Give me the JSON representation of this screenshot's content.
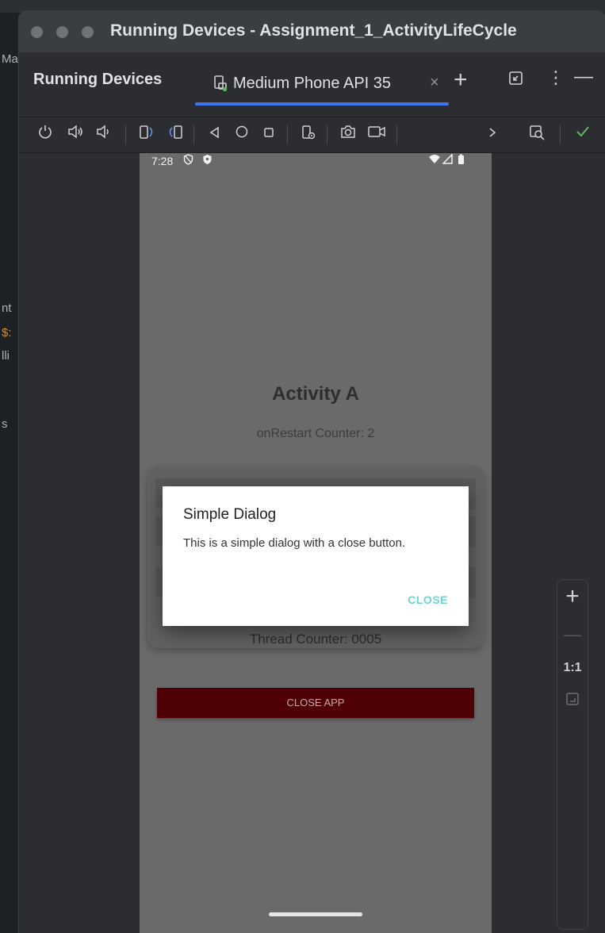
{
  "background": {
    "left_glyphs": [
      "Ma",
      "nt",
      "$:",
      "lli",
      "s"
    ]
  },
  "window": {
    "title": "Running Devices - Assignment_1_ActivityLifeCycle"
  },
  "tabbar": {
    "title": "Running Devices",
    "device_tab_label": "Medium Phone API 35",
    "close_glyph": "×",
    "add_glyph": "+"
  },
  "toolbar": {
    "icons": [
      "power-icon",
      "volume-up-icon",
      "volume-down-icon",
      "rotate-left-icon",
      "rotate-right-icon",
      "back-icon",
      "home-icon",
      "overview-icon",
      "device-settings-icon",
      "screenshot-icon",
      "screen-record-icon",
      "more-icon",
      "inspect-icon",
      "check-icon"
    ]
  },
  "phone": {
    "status": {
      "time": "7:28"
    },
    "activity_title": "Activity A",
    "restart_counter": "onRestart Counter: 2",
    "thread_counter": "Thread Counter: 0005",
    "close_app_label": "CLOSE APP",
    "dialog": {
      "title": "Simple Dialog",
      "message": "This is a simple dialog with a close button.",
      "close_label": "CLOSE"
    }
  },
  "zoom": {
    "plus": "+",
    "minus": "—",
    "one_to_one": "1:1"
  },
  "colors": {
    "accent_blue": "#3e76f0",
    "dialog_button": "#6fd5cc",
    "close_app_bg": "#4f0004",
    "success_green": "#5fb865"
  }
}
